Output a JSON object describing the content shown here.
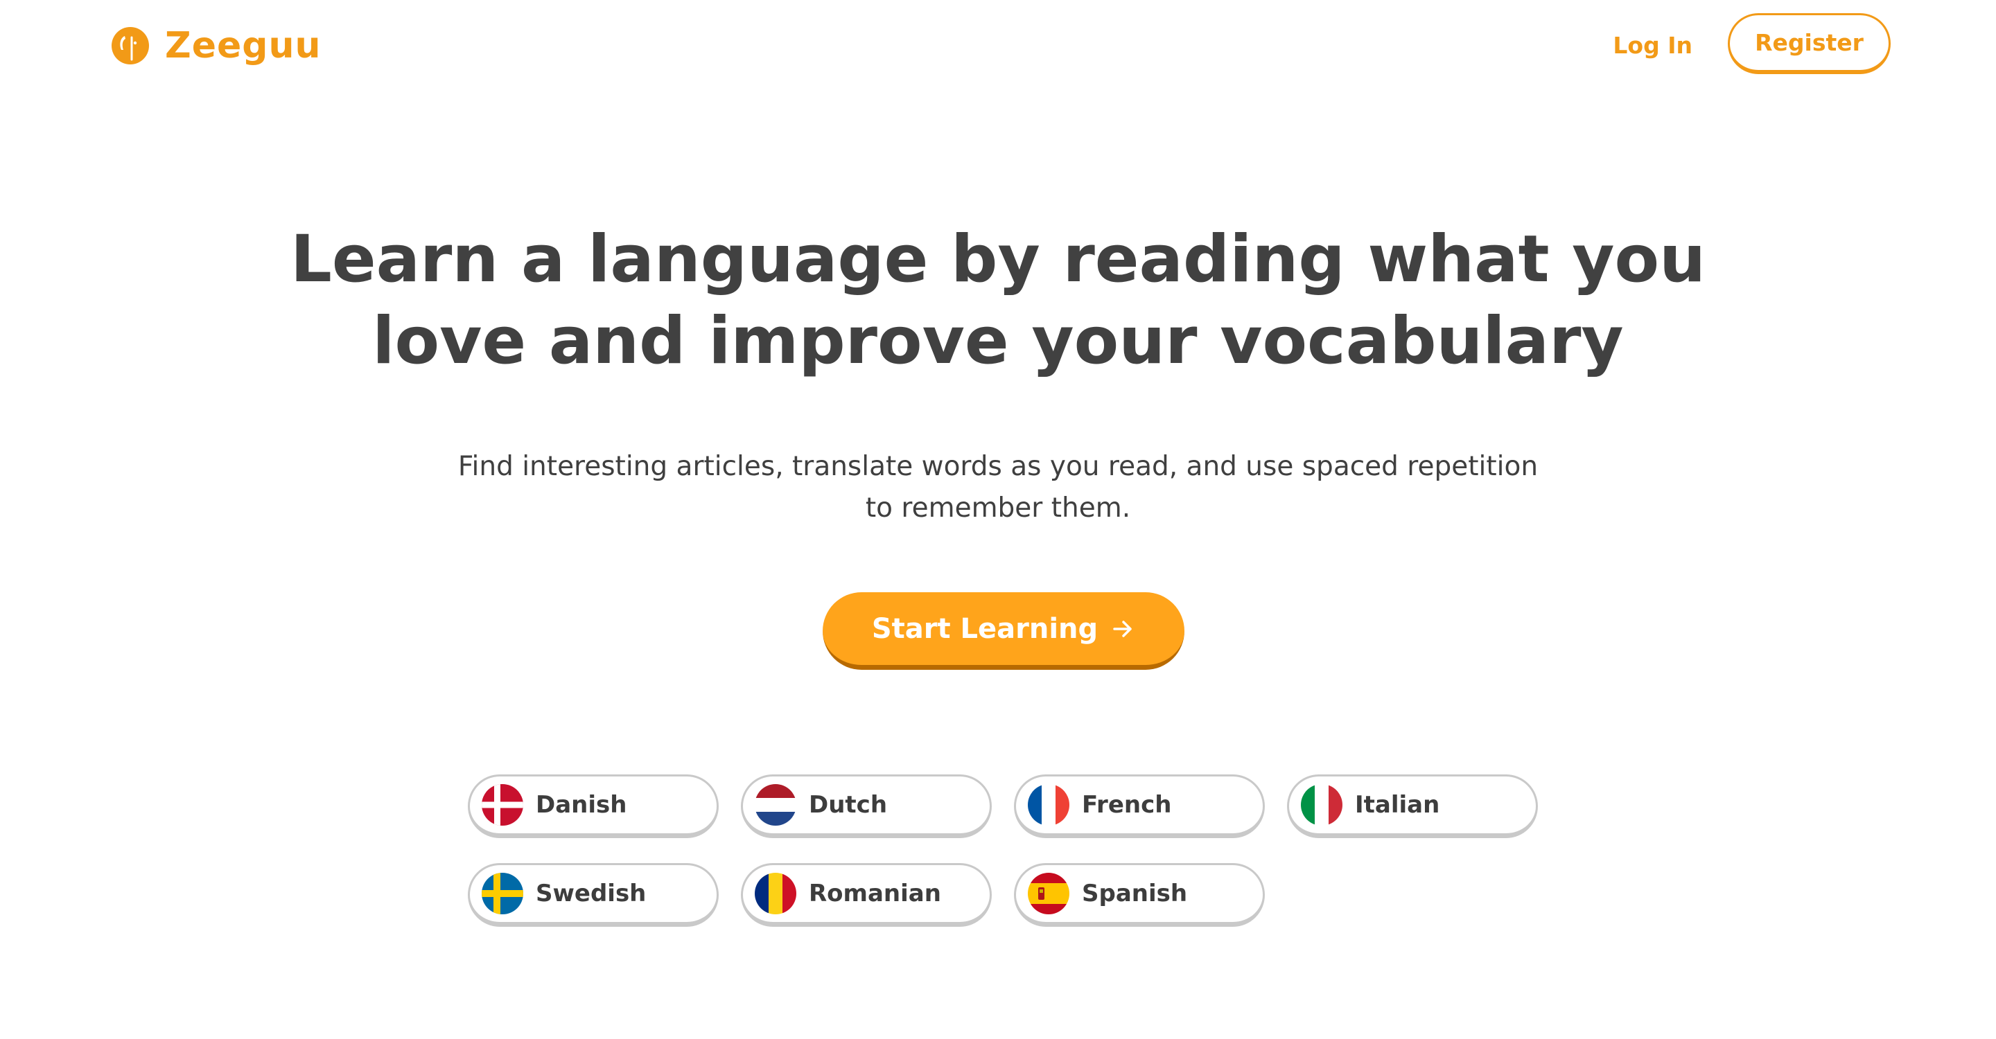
{
  "header": {
    "brand": "Zeeguu",
    "login_label": "Log In",
    "register_label": "Register"
  },
  "hero": {
    "headline_line1": "Learn a language by reading what you",
    "headline_line2": "love and improve your vocabulary",
    "subtitle_line1": "Find interesting articles, translate words as you read, and use spaced repetition",
    "subtitle_line2": "to remember them.",
    "cta_label": "Start Learning",
    "cta_icon": "arrow-right-icon"
  },
  "languages": [
    {
      "label": "Danish",
      "icon": "danish-flag-icon"
    },
    {
      "label": "Dutch",
      "icon": "dutch-flag-icon"
    },
    {
      "label": "French",
      "icon": "french-flag-icon"
    },
    {
      "label": "Italian",
      "icon": "italian-flag-icon"
    },
    {
      "label": "Swedish",
      "icon": "swedish-flag-icon"
    },
    {
      "label": "Romanian",
      "icon": "romanian-flag-icon"
    },
    {
      "label": "Spanish",
      "icon": "spanish-flag-icon"
    }
  ],
  "colors": {
    "accent": "#f29a17",
    "cta_background": "#ffa41b",
    "text": "#414141"
  }
}
